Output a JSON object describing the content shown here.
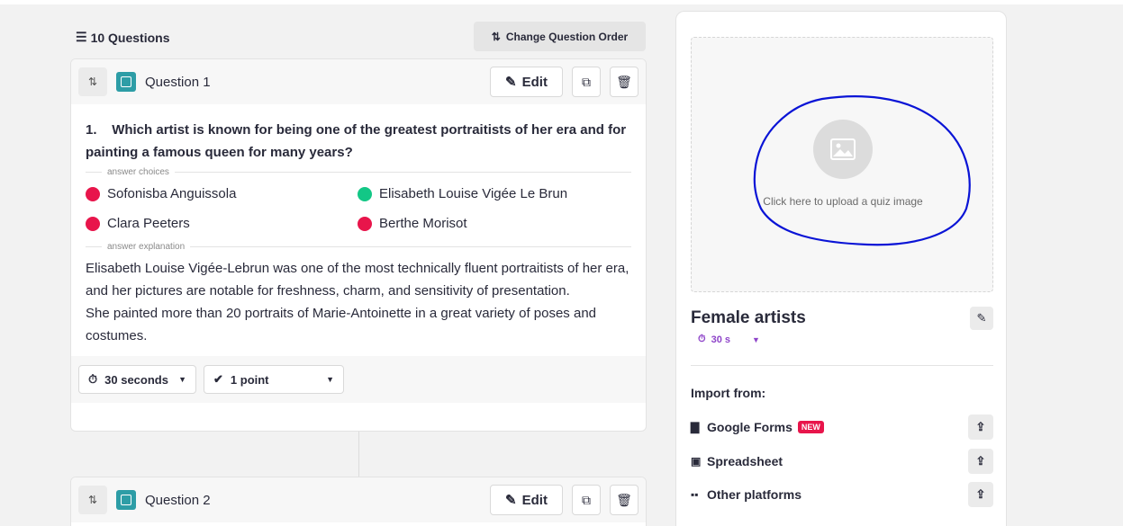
{
  "header": {
    "questions_count": "10 Questions",
    "change_order_label": "Change Question Order"
  },
  "questions": [
    {
      "label": "Question 1",
      "edit_label": "Edit",
      "number": "1.",
      "text": "Which artist is known for being one of the greatest portraitists of her era and for painting a famous queen for many years?",
      "answer_choices_label": "answer choices",
      "choices": [
        {
          "text": "Sofonisba Anguissola",
          "correct": false
        },
        {
          "text": "Elisabeth Louise Vigée Le Brun",
          "correct": true
        },
        {
          "text": "Clara Peeters",
          "correct": false
        },
        {
          "text": "Berthe Morisot",
          "correct": false
        }
      ],
      "explanation_label": "answer explanation",
      "explanation_lines": [
        "Elisabeth Louise Vigée-Lebrun was one of the most technically fluent portraitists of her era,",
        "and her pictures are notable for freshness, charm, and sensitivity of presentation.",
        "She painted more than 20 portraits of Marie-Antoinette in a great variety of poses and",
        "costumes."
      ],
      "time_label": "30 seconds",
      "points_label": "1 point"
    },
    {
      "label": "Question 2",
      "edit_label": "Edit"
    }
  ],
  "sidebar": {
    "upload_text": "Click here to upload a quiz image",
    "quiz_title": "Female artists",
    "timer": "30 s",
    "import_title": "Import from:",
    "imports": [
      {
        "label": "Google Forms",
        "badge": "NEW",
        "icon": "document-icon"
      },
      {
        "label": "Spreadsheet",
        "icon": "spreadsheet-icon"
      },
      {
        "label": "Other platforms",
        "icon": "grid-icon"
      }
    ]
  },
  "colors": {
    "correct": "#13c786",
    "wrong": "#e8154b",
    "accent_purple": "#8e44c9",
    "question_type": "#2d9da6",
    "annotation_ink": "#0a14d6"
  }
}
